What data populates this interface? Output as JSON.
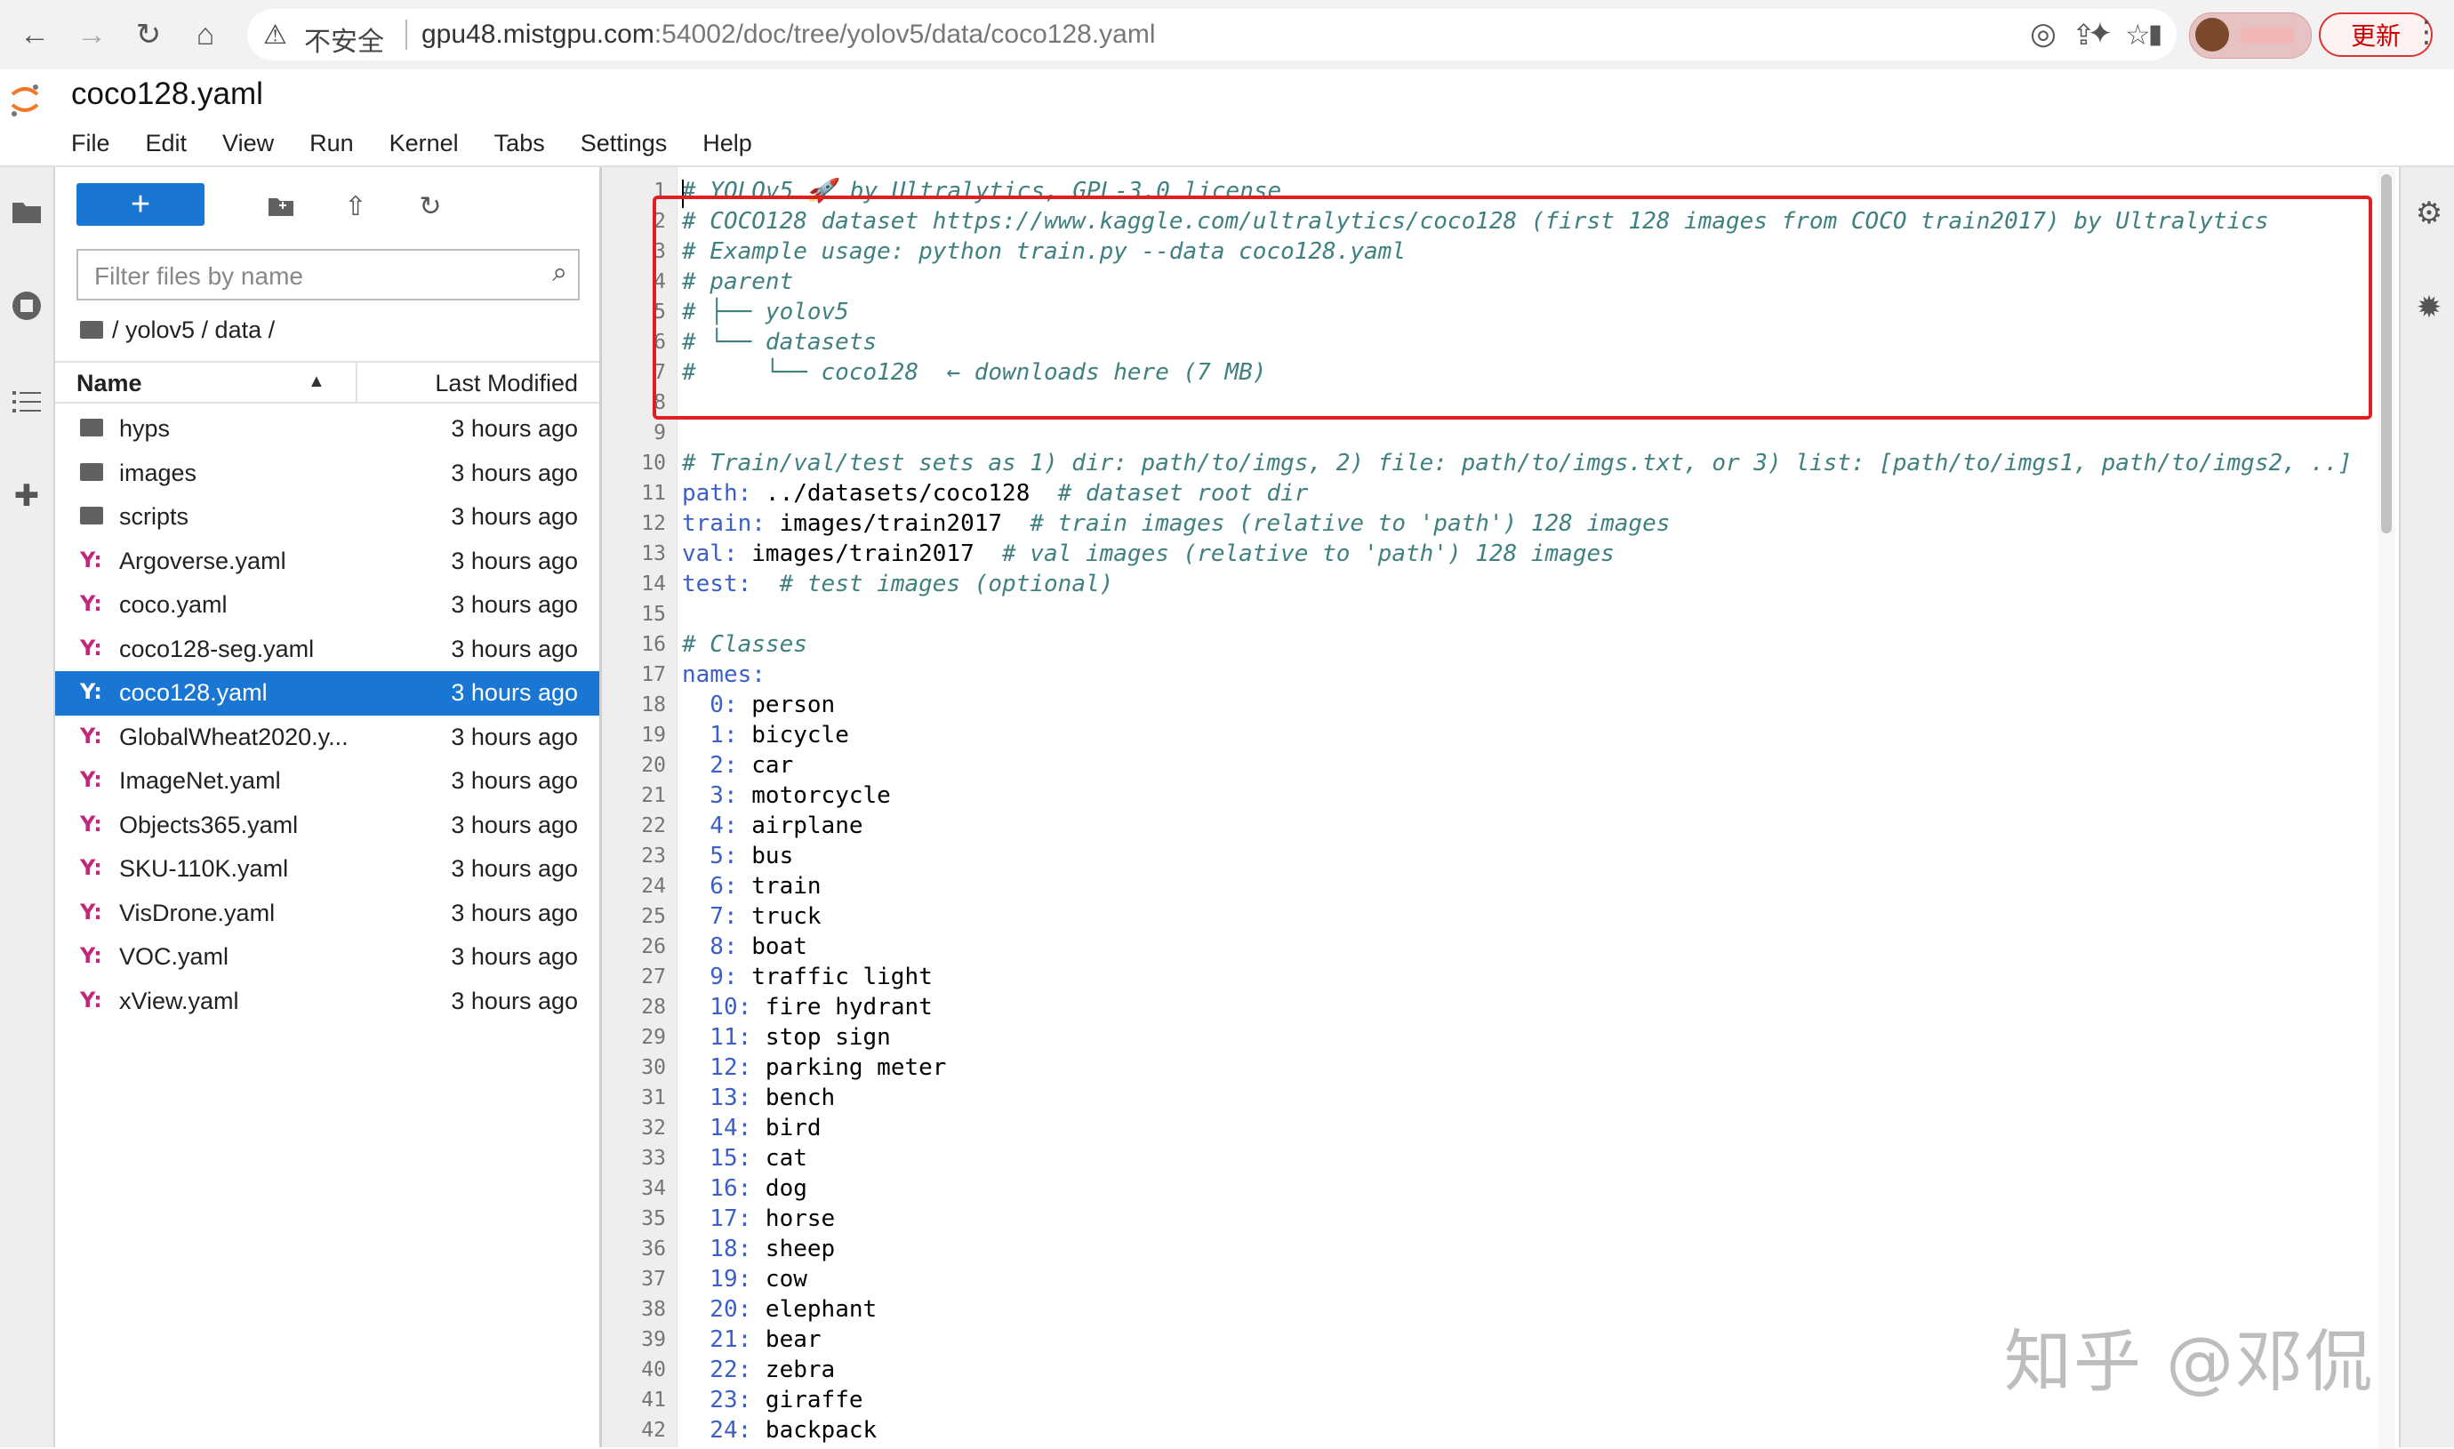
{
  "browser": {
    "security_label": "不安全",
    "url_host": "gpu48.mistgpu.com",
    "url_rest": ":54002/doc/tree/yolov5/data/coco128.yaml",
    "update_label": "更新",
    "icons": [
      "back-icon",
      "forward-icon",
      "reload-icon",
      "home-icon",
      "warning-icon",
      "share-icon",
      "star-icon",
      "extension-icon",
      "puzzle-icon",
      "sidepanel-icon",
      "menu-dots-icon"
    ]
  },
  "jupyter": {
    "doc_title": "coco128.yaml",
    "menu": [
      "File",
      "Edit",
      "View",
      "Run",
      "Kernel",
      "Tabs",
      "Settings",
      "Help"
    ]
  },
  "filebrowser": {
    "new_label": "+",
    "filter_placeholder": "Filter files by name",
    "breadcrumb": "/ yolov5 / data /",
    "col_name": "Name",
    "col_modified": "Last Modified",
    "files": [
      {
        "name": "hyps",
        "type": "folder",
        "modified": "3 hours ago"
      },
      {
        "name": "images",
        "type": "folder",
        "modified": "3 hours ago"
      },
      {
        "name": "scripts",
        "type": "folder",
        "modified": "3 hours ago"
      },
      {
        "name": "Argoverse.yaml",
        "type": "yaml",
        "modified": "3 hours ago"
      },
      {
        "name": "coco.yaml",
        "type": "yaml",
        "modified": "3 hours ago"
      },
      {
        "name": "coco128-seg.yaml",
        "type": "yaml",
        "modified": "3 hours ago"
      },
      {
        "name": "coco128.yaml",
        "type": "yaml",
        "modified": "3 hours ago",
        "selected": true
      },
      {
        "name": "GlobalWheat2020.y...",
        "type": "yaml",
        "modified": "3 hours ago"
      },
      {
        "name": "ImageNet.yaml",
        "type": "yaml",
        "modified": "3 hours ago"
      },
      {
        "name": "Objects365.yaml",
        "type": "yaml",
        "modified": "3 hours ago"
      },
      {
        "name": "SKU-110K.yaml",
        "type": "yaml",
        "modified": "3 hours ago"
      },
      {
        "name": "VisDrone.yaml",
        "type": "yaml",
        "modified": "3 hours ago"
      },
      {
        "name": "VOC.yaml",
        "type": "yaml",
        "modified": "3 hours ago"
      },
      {
        "name": "xView.yaml",
        "type": "yaml",
        "modified": "3 hours ago"
      }
    ]
  },
  "editor": {
    "lines": [
      [
        {
          "t": "# YOLOv5 🚀 by Ultralytics, GPL-3.0 license",
          "c": "cmt"
        }
      ],
      [
        {
          "t": "# COCO128 dataset https://www.kaggle.com/ultralytics/coco128 (first 128 images from COCO train2017) by Ultralytics",
          "c": "cmt"
        }
      ],
      [
        {
          "t": "# Example usage: python train.py --data coco128.yaml",
          "c": "cmt"
        }
      ],
      [
        {
          "t": "# parent",
          "c": "cmt"
        }
      ],
      [
        {
          "t": "# ├── yolov5",
          "c": "cmt"
        }
      ],
      [
        {
          "t": "# └── datasets",
          "c": "cmt"
        }
      ],
      [
        {
          "t": "#     └── coco128  ← downloads here (7 MB)",
          "c": "cmt"
        }
      ],
      [],
      [],
      [
        {
          "t": "# Train/val/test sets as 1) dir: path/to/imgs, 2) file: path/to/imgs.txt, or 3) list: [path/to/imgs1, path/to/imgs2, ..]",
          "c": "cmt"
        }
      ],
      [
        {
          "t": "path:",
          "c": "key"
        },
        {
          "t": " ../datasets/coco128  ",
          "c": "plain"
        },
        {
          "t": "# dataset root dir",
          "c": "cmt"
        }
      ],
      [
        {
          "t": "train:",
          "c": "key"
        },
        {
          "t": " images/train2017  ",
          "c": "plain"
        },
        {
          "t": "# train images (relative to 'path') 128 images",
          "c": "cmt"
        }
      ],
      [
        {
          "t": "val:",
          "c": "key"
        },
        {
          "t": " images/train2017  ",
          "c": "plain"
        },
        {
          "t": "# val images (relative to 'path') 128 images",
          "c": "cmt"
        }
      ],
      [
        {
          "t": "test:",
          "c": "key"
        },
        {
          "t": "  ",
          "c": "plain"
        },
        {
          "t": "# test images (optional)",
          "c": "cmt"
        }
      ],
      [],
      [
        {
          "t": "# Classes",
          "c": "cmt"
        }
      ],
      [
        {
          "t": "names:",
          "c": "key"
        }
      ],
      [
        {
          "t": "  0:",
          "c": "num"
        },
        {
          "t": " person",
          "c": "plain"
        }
      ],
      [
        {
          "t": "  1:",
          "c": "num"
        },
        {
          "t": " bicycle",
          "c": "plain"
        }
      ],
      [
        {
          "t": "  2:",
          "c": "num"
        },
        {
          "t": " car",
          "c": "plain"
        }
      ],
      [
        {
          "t": "  3:",
          "c": "num"
        },
        {
          "t": " motorcycle",
          "c": "plain"
        }
      ],
      [
        {
          "t": "  4:",
          "c": "num"
        },
        {
          "t": " airplane",
          "c": "plain"
        }
      ],
      [
        {
          "t": "  5:",
          "c": "num"
        },
        {
          "t": " bus",
          "c": "plain"
        }
      ],
      [
        {
          "t": "  6:",
          "c": "num"
        },
        {
          "t": " train",
          "c": "plain"
        }
      ],
      [
        {
          "t": "  7:",
          "c": "num"
        },
        {
          "t": " truck",
          "c": "plain"
        }
      ],
      [
        {
          "t": "  8:",
          "c": "num"
        },
        {
          "t": " boat",
          "c": "plain"
        }
      ],
      [
        {
          "t": "  9:",
          "c": "num"
        },
        {
          "t": " traffic light",
          "c": "plain"
        }
      ],
      [
        {
          "t": "  10:",
          "c": "num"
        },
        {
          "t": " fire hydrant",
          "c": "plain"
        }
      ],
      [
        {
          "t": "  11:",
          "c": "num"
        },
        {
          "t": " stop sign",
          "c": "plain"
        }
      ],
      [
        {
          "t": "  12:",
          "c": "num"
        },
        {
          "t": " parking meter",
          "c": "plain"
        }
      ],
      [
        {
          "t": "  13:",
          "c": "num"
        },
        {
          "t": " bench",
          "c": "plain"
        }
      ],
      [
        {
          "t": "  14:",
          "c": "num"
        },
        {
          "t": " bird",
          "c": "plain"
        }
      ],
      [
        {
          "t": "  15:",
          "c": "num"
        },
        {
          "t": " cat",
          "c": "plain"
        }
      ],
      [
        {
          "t": "  16:",
          "c": "num"
        },
        {
          "t": " dog",
          "c": "plain"
        }
      ],
      [
        {
          "t": "  17:",
          "c": "num"
        },
        {
          "t": " horse",
          "c": "plain"
        }
      ],
      [
        {
          "t": "  18:",
          "c": "num"
        },
        {
          "t": " sheep",
          "c": "plain"
        }
      ],
      [
        {
          "t": "  19:",
          "c": "num"
        },
        {
          "t": " cow",
          "c": "plain"
        }
      ],
      [
        {
          "t": "  20:",
          "c": "num"
        },
        {
          "t": " elephant",
          "c": "plain"
        }
      ],
      [
        {
          "t": "  21:",
          "c": "num"
        },
        {
          "t": " bear",
          "c": "plain"
        }
      ],
      [
        {
          "t": "  22:",
          "c": "num"
        },
        {
          "t": " zebra",
          "c": "plain"
        }
      ],
      [
        {
          "t": "  23:",
          "c": "num"
        },
        {
          "t": " giraffe",
          "c": "plain"
        }
      ],
      [
        {
          "t": "  24:",
          "c": "num"
        },
        {
          "t": " backpack",
          "c": "plain"
        }
      ]
    ]
  },
  "watermark": "知乎 @邓侃"
}
